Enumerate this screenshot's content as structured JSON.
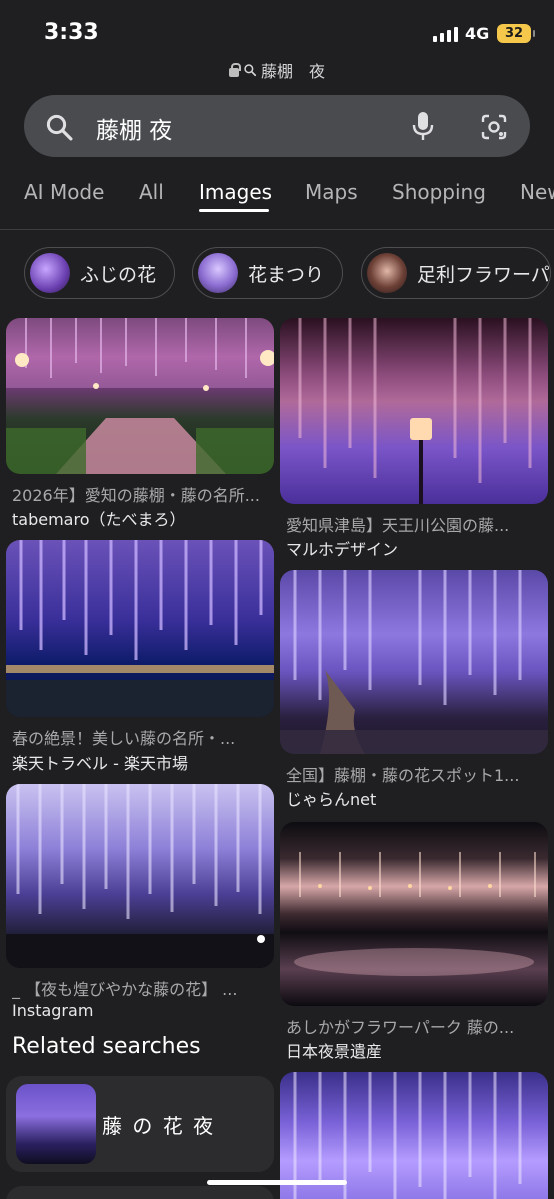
{
  "status": {
    "time": "3:33",
    "network": "4G",
    "battery": "32"
  },
  "url_bar": {
    "text": "藤棚　夜"
  },
  "search": {
    "query": "藤棚 夜"
  },
  "tabs": [
    "AI Mode",
    "All",
    "Images",
    "Maps",
    "Shopping",
    "New"
  ],
  "active_tab": "Images",
  "chips": [
    {
      "label": "ふじの花"
    },
    {
      "label": "花まつり"
    },
    {
      "label": "足利フラワーパ"
    }
  ],
  "results_left": [
    {
      "title": "2026年】愛知の藤棚・藤の名所...",
      "source": "tabemaro（たべまろ）"
    },
    {
      "title": "春の絶景！美しい藤の名所・...",
      "source": "楽天トラベル - 楽天市場"
    },
    {
      "title": "_ 【夜も煌びやかな藤の花】 ...",
      "source": "Instagram"
    }
  ],
  "results_right": [
    {
      "title": "愛知県津島】天王川公園の藤...",
      "source": "マルホデザイン"
    },
    {
      "title": "全国】藤棚・藤の花スポット1...",
      "source": "じゃらんnet"
    },
    {
      "title": "あしかがフラワーパーク 藤の...",
      "source": "日本夜景遺産"
    }
  ],
  "related": {
    "heading": "Related searches",
    "items": [
      {
        "label": "藤 の 花 夜"
      }
    ]
  },
  "colors": {
    "background": "#1f1f21",
    "search_box": "#4a4b4f",
    "wisteria": "#9a7be0"
  }
}
